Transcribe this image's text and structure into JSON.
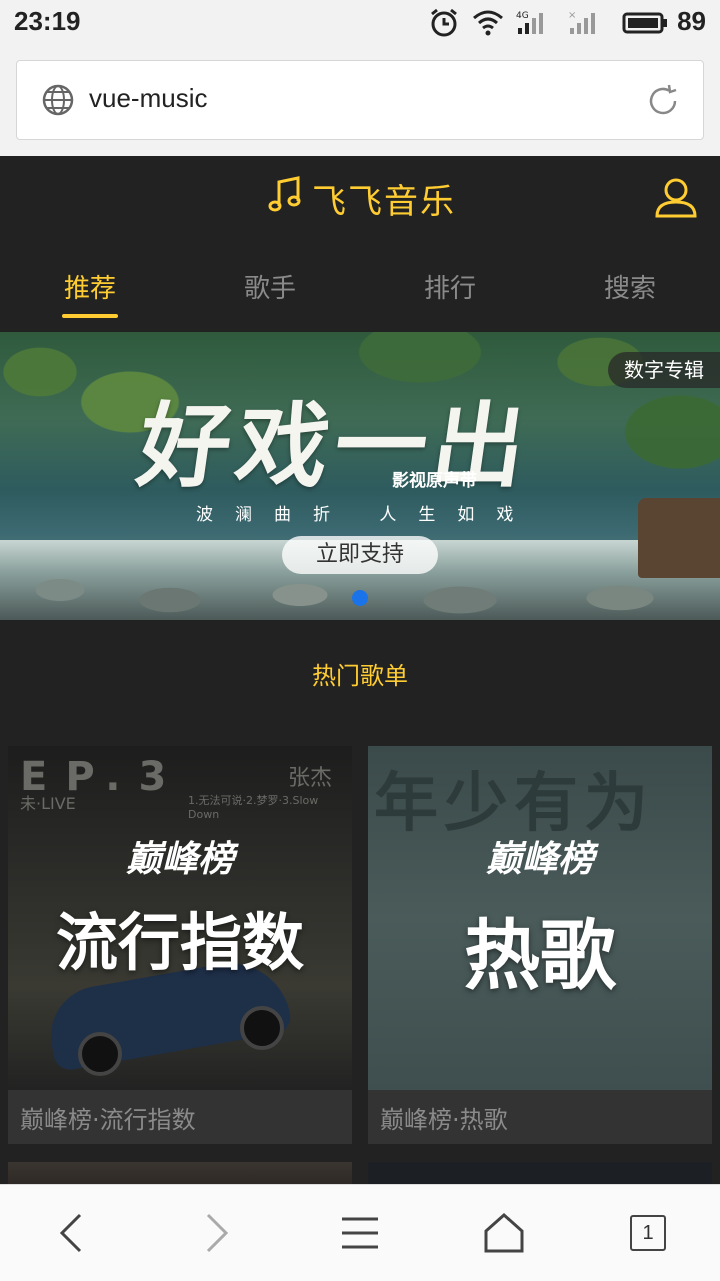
{
  "status_bar": {
    "time": "23:19",
    "battery_percent": "89",
    "network": "4G"
  },
  "browser": {
    "url": "vue-music"
  },
  "app": {
    "title": "飞飞音乐",
    "accent_color": "#ffcd32",
    "tabs": [
      {
        "label": "推荐",
        "active": true
      },
      {
        "label": "歌手",
        "active": false
      },
      {
        "label": "排行",
        "active": false
      },
      {
        "label": "搜索",
        "active": false
      }
    ]
  },
  "banner": {
    "title": "好戏一出",
    "tag": "影视原声带",
    "subtitle": "波澜曲折 人生如戏",
    "button": "立即支持",
    "badge": "数字专辑"
  },
  "section": {
    "title": "热门歌单"
  },
  "playlists": [
    {
      "name": "巅峰榜·流行指数",
      "cover_brand": "巅峰榜",
      "cover_text": "流行指数",
      "cover_ep": "EP.3",
      "cover_artist": "张杰",
      "cover_live": "未·LIVE",
      "cover_tracks": "1.无法可说·2.梦罗·3.Slow Down"
    },
    {
      "name": "巅峰榜·热歌",
      "cover_brand": "巅峰榜",
      "cover_text": "热歌",
      "cover_bg": "年少有为"
    }
  ],
  "bottom_nav": {
    "tab_count": "1"
  }
}
